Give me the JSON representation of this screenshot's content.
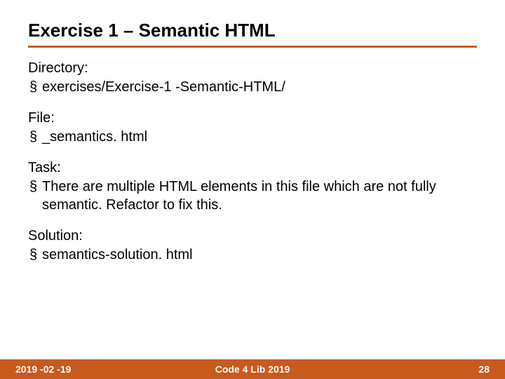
{
  "title": "Exercise 1 – Semantic HTML",
  "sections": {
    "directory": {
      "label": "Directory:",
      "item": "exercises/Exercise-1 -Semantic-HTML/"
    },
    "file": {
      "label": "File:",
      "item": "_semantics. html"
    },
    "task": {
      "label": "Task:",
      "item": "There are multiple HTML elements in this file which are not fully semantic. Refactor to fix this."
    },
    "solution": {
      "label": "Solution:",
      "item": "semantics-solution. html"
    }
  },
  "footer": {
    "date": "2019 -02 -19",
    "center": "Code 4 Lib 2019",
    "page": "28"
  }
}
